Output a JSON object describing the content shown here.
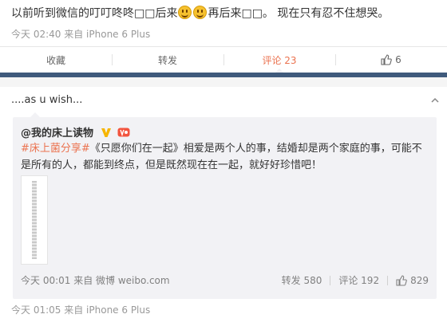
{
  "post": {
    "text_part1": "以前听到微信的叮叮咚咚□□后来",
    "text_part2": "再后来□□。 现在只有忍不住想哭。",
    "emoji_name": "smile-emoji",
    "time": "今天 02:40",
    "source": "来自 iPhone 6 Plus"
  },
  "actions": {
    "favorite": "收藏",
    "repost": "转发",
    "comment": "评论 23",
    "like": "6"
  },
  "colors": {
    "accent": "#eb7350",
    "separator": "#3f5a7c",
    "quote_bg": "#f2f2f5"
  },
  "comment": {
    "text": "....as u wish...",
    "time": "今天 01:05",
    "source": "来自 iPhone 6 Plus"
  },
  "quote": {
    "author": "@我的床上读物",
    "topic": "#床上菌分享#",
    "body": "《只愿你们在一起》相爱是两个人的事，结婚却是两个家庭的事，可能不是所有的人，都能到终点，但是既然现在在一起，就好好珍惜吧！",
    "time": "今天 00:01",
    "source": "来自 微博 weibo.com",
    "repost": "转发 580",
    "comment": "评论 192",
    "like": "829"
  }
}
